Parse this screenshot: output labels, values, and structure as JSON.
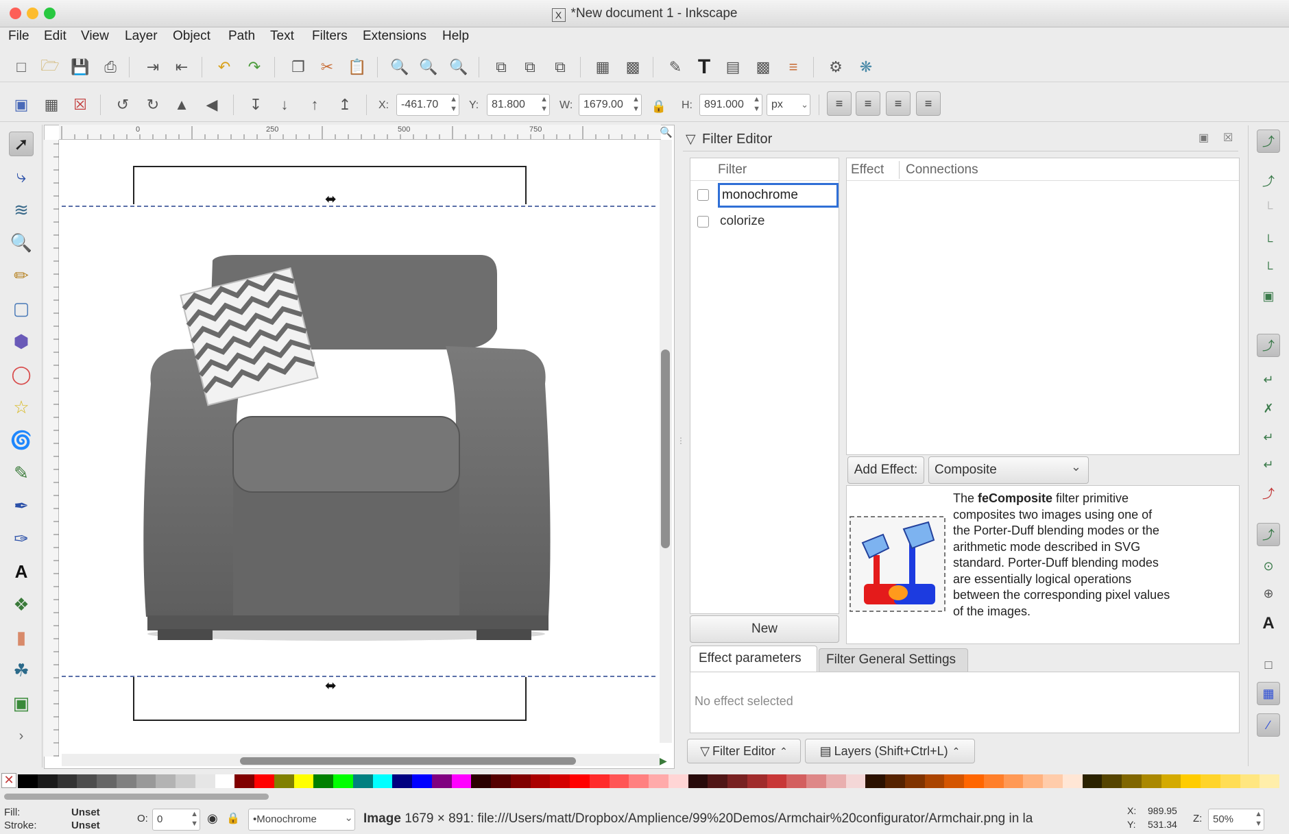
{
  "window": {
    "title": "*New document 1 - Inkscape",
    "x_icon": "X"
  },
  "menu": [
    "File",
    "Edit",
    "View",
    "Layer",
    "Object",
    "Path",
    "Text",
    "Filters",
    "Extensions",
    "Help"
  ],
  "toolbar_controls": {
    "x_label": "X:",
    "x_value": "-461.70",
    "y_label": "Y:",
    "y_value": "81.800",
    "w_label": "W:",
    "w_value": "1679.00",
    "h_label": "H:",
    "h_value": "891.000",
    "unit": "px"
  },
  "ruler_labels": [
    "0",
    "250",
    "500",
    "750"
  ],
  "filter_editor": {
    "title": "Filter Editor",
    "filter_header": "Filter",
    "filters": [
      {
        "name": "monochrome",
        "selected": true
      },
      {
        "name": "colorize",
        "selected": false
      }
    ],
    "new_button": "New",
    "effect_header": "Effect",
    "connections_header": "Connections",
    "add_effect_label": "Add Effect:",
    "add_effect_value": "Composite",
    "description_prefix": "The ",
    "description_bold": "feComposite",
    "description_rest": " filter primitive composites two images using one of the Porter-Duff blending modes or the arithmetic mode described in SVG standard. Porter-Duff blending modes are essentially logical operations between the corresponding pixel values of the images.",
    "tabs": [
      "Effect parameters",
      "Filter General Settings"
    ],
    "no_effect_text": "No effect selected"
  },
  "dock_tabs": [
    "Filter Editor",
    "Layers (Shift+Ctrl+L)"
  ],
  "status": {
    "fill_label": "Fill:",
    "stroke_label": "Stroke:",
    "fill_value": "Unset",
    "stroke_value": "Unset",
    "opacity_label": "O:",
    "opacity_value": "0",
    "layer_value": "•Monochrome",
    "message_bold": "Image",
    "message": " 1679 × 891: file:///Users/matt/Dropbox/Amplience/99%20Demos/Armchair%20configurator/Armchair.png in la",
    "x_label": "X:",
    "y_label": "Y:",
    "cursor_x": "989.95",
    "cursor_y": "531.34",
    "zoom_label": "Z:",
    "zoom_value": "50%"
  },
  "colors": {
    "accent": "#2f6fd6",
    "close": "#fd5f57",
    "minimize": "#fdbc2e",
    "maximize": "#28c840",
    "sofa": "#6f6f6f"
  }
}
